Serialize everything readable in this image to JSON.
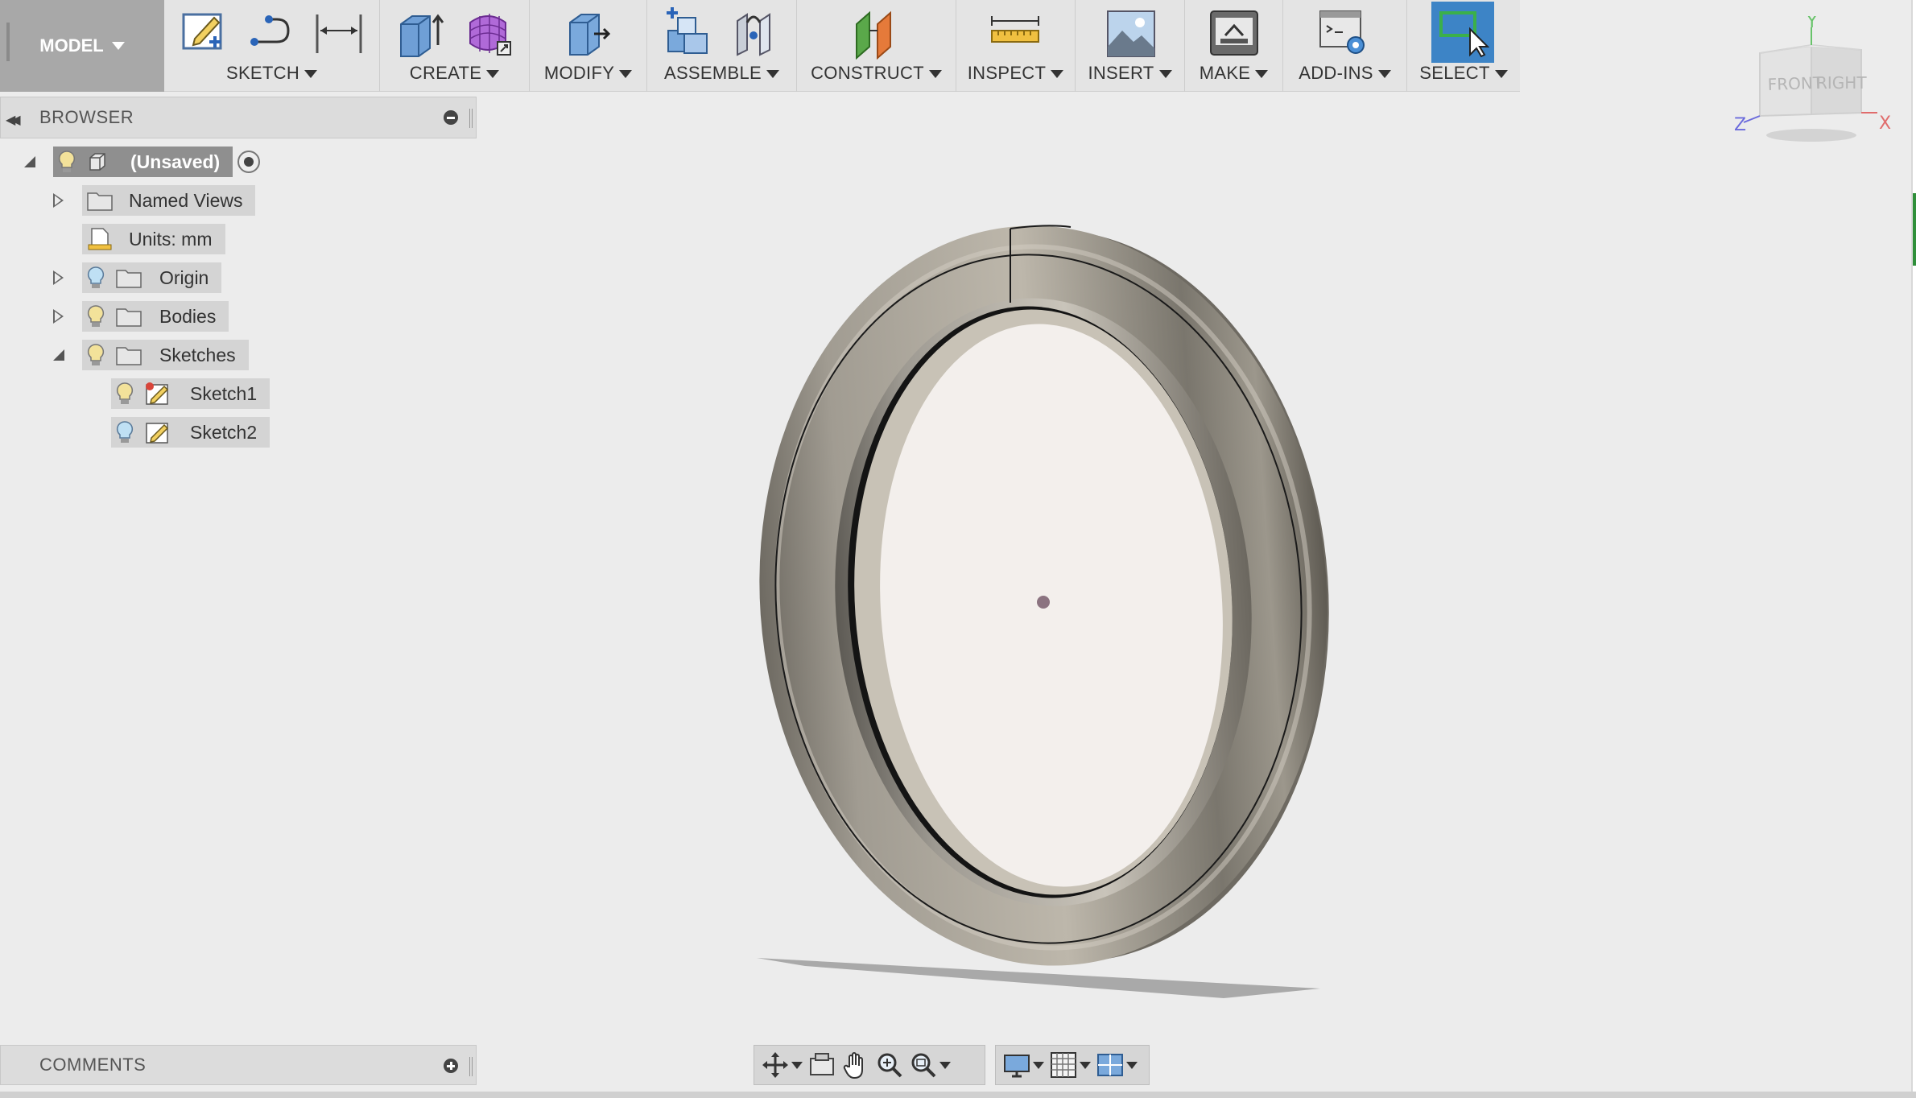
{
  "toolbar": {
    "mode_label": "MODEL",
    "groups": [
      {
        "label": "SKETCH"
      },
      {
        "label": "CREATE"
      },
      {
        "label": "MODIFY"
      },
      {
        "label": "ASSEMBLE"
      },
      {
        "label": "CONSTRUCT"
      },
      {
        "label": "INSPECT"
      },
      {
        "label": "INSERT"
      },
      {
        "label": "MAKE"
      },
      {
        "label": "ADD-INS"
      },
      {
        "label": "SELECT"
      }
    ]
  },
  "browser": {
    "title": "BROWSER",
    "root": "(Unsaved)",
    "items": [
      {
        "label": "Named Views"
      },
      {
        "label": "Units: mm"
      },
      {
        "label": "Origin"
      },
      {
        "label": "Bodies"
      },
      {
        "label": "Sketches"
      },
      {
        "label": "Sketch1"
      },
      {
        "label": "Sketch2"
      }
    ]
  },
  "comments": {
    "title": "COMMENTS"
  },
  "viewcube": {
    "front": "FRONT",
    "right": "RIGHT",
    "axis_x": "X",
    "axis_y": "Y",
    "axis_z": "Z"
  },
  "colors": {
    "select_active": "#3d84c6",
    "accent_blue": "#4a8fd6"
  }
}
